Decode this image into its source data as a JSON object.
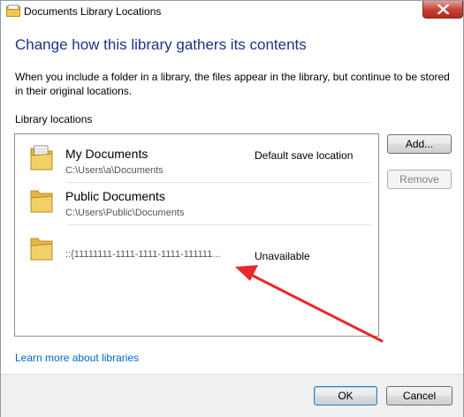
{
  "window": {
    "title": "Documents Library Locations"
  },
  "heading": "Change how this library gathers its contents",
  "description": "When you include a folder in a library, the files appear in the library, but continue to be stored in their original locations.",
  "section_label": "Library locations",
  "locations": [
    {
      "name": "My Documents",
      "path": "C:\\Users\\a\\Documents",
      "status": "Default save location",
      "icon": "documents-folder-icon"
    },
    {
      "name": "Public Documents",
      "path": "C:\\Users\\Public\\Documents",
      "status": "",
      "icon": "folder-icon"
    },
    {
      "name": "",
      "path": "::{11111111-1111-1111-1111-111111...",
      "status": "Unavailable",
      "icon": "folder-icon"
    }
  ],
  "buttons": {
    "add": "Add...",
    "remove": "Remove",
    "ok": "OK",
    "cancel": "Cancel"
  },
  "link": "Learn more about libraries",
  "colors": {
    "heading": "#1e3287",
    "link": "#0066cc",
    "annotation_arrow": "#e8282b"
  }
}
